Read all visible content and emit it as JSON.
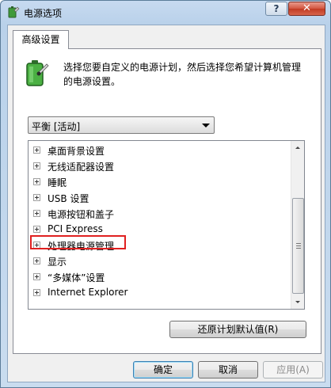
{
  "window": {
    "title": "电源选项",
    "help_label": "?",
    "close_label": "✕"
  },
  "tab": {
    "label": "高级设置"
  },
  "description": "选择您要自定义的电源计划，然后选择您希望计算机管理的电源设置。",
  "plan_select": {
    "value": "平衡 [活动]"
  },
  "tree_items": [
    {
      "label": "桌面背景设置"
    },
    {
      "label": "无线适配器设置"
    },
    {
      "label": "睡眠"
    },
    {
      "label": "USB 设置"
    },
    {
      "label": "电源按钮和盖子"
    },
    {
      "label": "PCI Express"
    },
    {
      "label": "处理器电源管理"
    },
    {
      "label": "显示"
    },
    {
      "label": "“多媒体”设置"
    },
    {
      "label": "Internet Explorer"
    }
  ],
  "buttons": {
    "restore": "还原计划默认值(R)",
    "ok": "确定",
    "cancel": "取消",
    "apply": "应用(A)"
  },
  "colors": {
    "highlight_box": "#e02020",
    "title_bg": "#b9d1ea"
  }
}
